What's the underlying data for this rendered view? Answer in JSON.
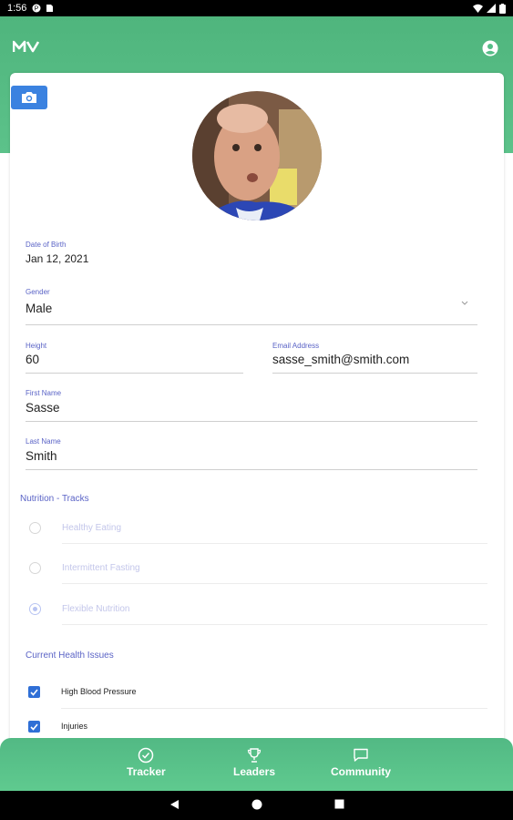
{
  "status_bar": {
    "time": "1:56"
  },
  "header": {
    "logo": "MV"
  },
  "profile": {
    "dob": {
      "label": "Date of Birth",
      "value": "Jan 12, 2021"
    },
    "gender": {
      "label": "Gender",
      "value": "Male"
    },
    "height": {
      "label": "Height",
      "value": "60"
    },
    "email": {
      "label": "Email Address",
      "value": "sasse_smith@smith.com"
    },
    "first_name": {
      "label": "First Name",
      "value": "Sasse"
    },
    "last_name": {
      "label": "Last Name",
      "value": "Smith"
    }
  },
  "nutrition": {
    "title": "Nutrition - Tracks",
    "options": [
      {
        "label": "Healthy Eating",
        "selected": false
      },
      {
        "label": "Intermittent Fasting",
        "selected": false
      },
      {
        "label": "Flexible Nutrition",
        "selected": true
      }
    ]
  },
  "health": {
    "title": "Current Health Issues",
    "issues": [
      {
        "label": "High Blood Pressure",
        "checked": true
      },
      {
        "label": "Injuries",
        "checked": true
      }
    ]
  },
  "bottom_nav": {
    "items": [
      {
        "label": "Tracker",
        "icon": "check-circle-icon"
      },
      {
        "label": "Leaders",
        "icon": "trophy-icon"
      },
      {
        "label": "Community",
        "icon": "chat-bubble-icon"
      }
    ]
  },
  "colors": {
    "primary_green": "#55bd87",
    "accent_blue": "#3b82e0",
    "label_purple": "#5a63c6"
  }
}
